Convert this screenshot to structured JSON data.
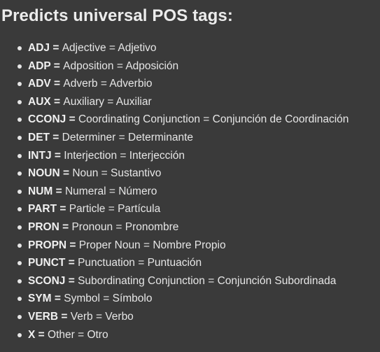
{
  "title": "Predicts universal POS tags:",
  "tags": [
    {
      "code": "ADJ",
      "sep": " = ",
      "desc": "Adjective = Adjetivo"
    },
    {
      "code": "ADP",
      "sep": " = ",
      "desc": "Adposition = Adposición"
    },
    {
      "code": "ADV",
      "sep": " = ",
      "desc": "Adverb = Adverbio"
    },
    {
      "code": "AUX",
      "sep": " = ",
      "desc": "Auxiliary = Auxiliar"
    },
    {
      "code": "CCONJ",
      "sep": " = ",
      "desc": "Coordinating Conjunction = Conjunción de Coordinación"
    },
    {
      "code": "DET",
      "sep": " = ",
      "desc": "Determiner = Determinante"
    },
    {
      "code": "INTJ",
      "sep": " = ",
      "desc": "Interjection = Interjección"
    },
    {
      "code": "NOUN",
      "sep": " = ",
      "desc": "Noun = Sustantivo"
    },
    {
      "code": "NUM",
      "sep": " = ",
      "desc": "Numeral = Número"
    },
    {
      "code": "PART",
      "sep": " = ",
      "desc": "Particle = Partícula"
    },
    {
      "code": "PRON",
      "sep": " = ",
      "desc": "Pronoun = Pronombre"
    },
    {
      "code": "PROPN",
      "sep": " = ",
      "desc": "Proper Noun = Nombre Propio"
    },
    {
      "code": "PUNCT",
      "sep": " = ",
      "desc": "Punctuation = Puntuación"
    },
    {
      "code": "SCONJ",
      "sep": " = ",
      "desc": "Subordinating Conjunction = Conjunción Subordinada"
    },
    {
      "code": "SYM",
      "sep": " = ",
      "desc": "Symbol = Símbolo"
    },
    {
      "code": "VERB",
      "sep": " = ",
      "desc": "Verb = Verbo"
    },
    {
      "code": "X",
      "sep": " = ",
      "desc": "Other = Otro"
    }
  ]
}
